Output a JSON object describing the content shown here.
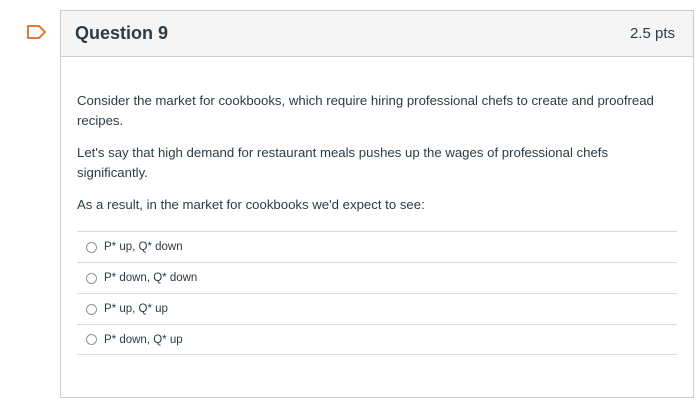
{
  "question": {
    "title": "Question 9",
    "points": "2.5 pts",
    "paragraphs": [
      "Consider the market for cookbooks, which require hiring professional chefs to create and proofread recipes.",
      "Let's say that high demand for restaurant meals pushes up the wages of professional chefs significantly.",
      "As a result, in the market for cookbooks we'd expect to see:"
    ],
    "answers": [
      "P* up, Q* down",
      "P* down, Q* down",
      "P* up, Q* up",
      "P* down, Q* up"
    ]
  },
  "icons": {
    "flag": "flag-icon"
  },
  "colors": {
    "flag_outline": "#e07b39",
    "header_bg": "#f5f5f5",
    "border": "#c7cdd1",
    "text": "#2d3b45"
  }
}
